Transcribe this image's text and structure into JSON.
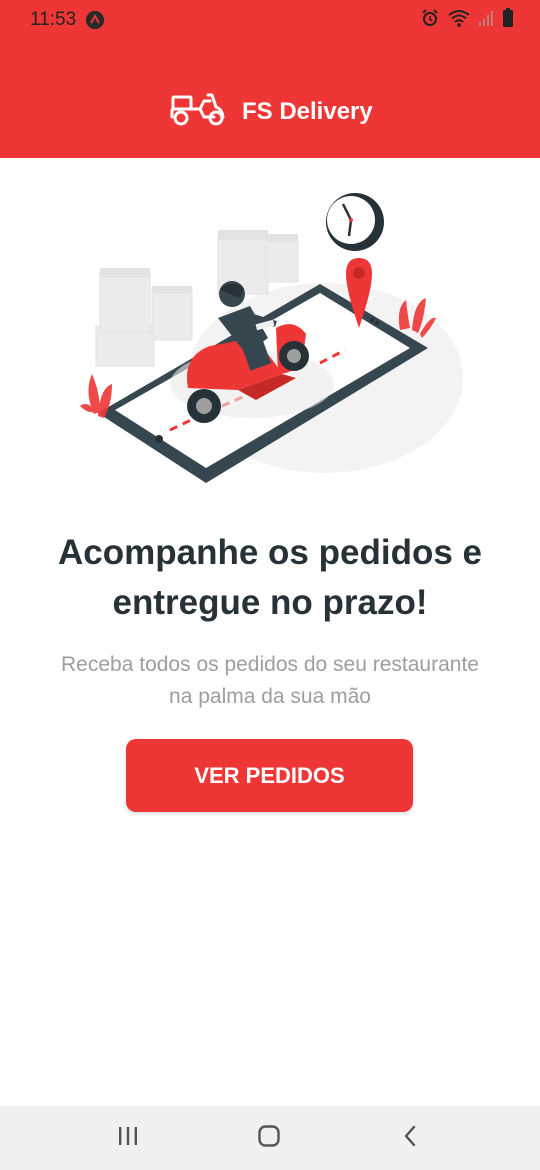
{
  "status_bar": {
    "time": "11:53",
    "icons": [
      "app-notification-icon",
      "alarm-icon",
      "wifi-icon",
      "signal-icon",
      "battery-icon"
    ]
  },
  "header": {
    "brand_name": "FS Delivery",
    "logo_icon": "scooter-icon",
    "background_color": "#ef3636"
  },
  "hero": {
    "illustration": "delivery-scooter-on-phone-illustration",
    "headline": "Acompanhe os pedidos e entregue no prazo!",
    "subtext": "Receba todos os pedidos do seu restaurante na palma da sua mão"
  },
  "cta": {
    "label": "VER PEDIDOS",
    "color": "#ef3636"
  },
  "nav_bar": {
    "buttons": [
      "recent-apps-icon",
      "home-icon",
      "back-icon"
    ]
  }
}
